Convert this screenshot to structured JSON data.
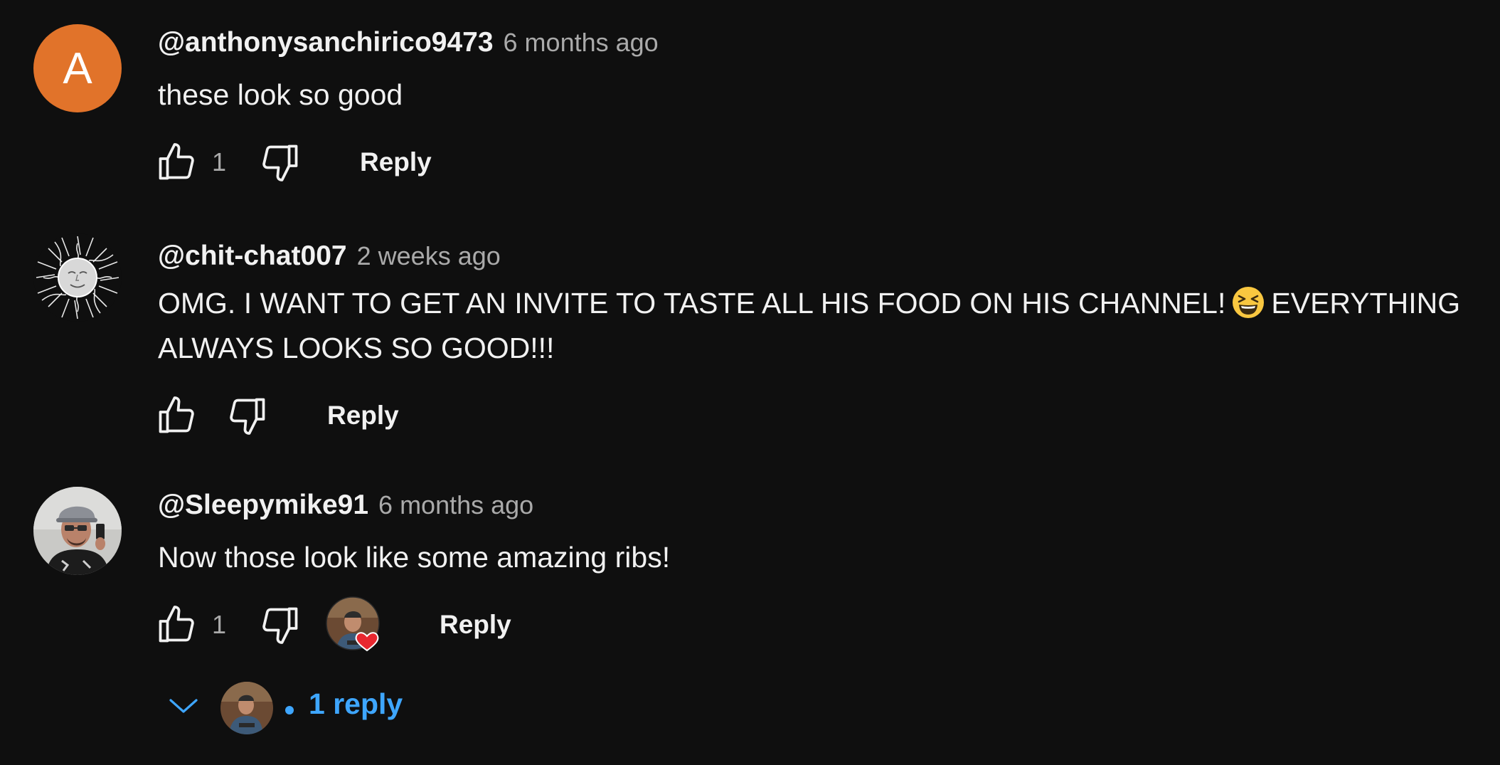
{
  "comments": [
    {
      "author": "@anthonysanchirico9473",
      "time": "6 months ago",
      "text": "these look so good",
      "avatar_letter": "A",
      "avatar_color": "#e1732a",
      "likes": "1",
      "reply_label": "Reply"
    },
    {
      "author": "@chit-chat007",
      "time": "2 weeks ago",
      "text_before_emoji": "OMG. I WANT TO GET AN INVITE TO TASTE ALL HIS FOOD ON HIS CHANNEL!",
      "emoji": "grinning-squinting-face",
      "text_after_emoji": "EVERYTHING ALWAYS LOOKS SO GOOD!!!",
      "avatar_icon": "sun-drawing-avatar",
      "likes": "",
      "reply_label": "Reply"
    },
    {
      "author": "@Sleepymike91",
      "time": "6 months ago",
      "text": "Now those look like some amazing ribs!",
      "avatar_icon": "user-photo-avatar",
      "likes": "1",
      "creator_heart": true,
      "reply_label": "Reply",
      "replies_label": "1 reply"
    }
  ],
  "colors": {
    "background": "#0f0f0f",
    "text": "#f1f1f1",
    "muted": "#aaaaaa",
    "link": "#3ea6ff",
    "heart": "#e8272f"
  }
}
